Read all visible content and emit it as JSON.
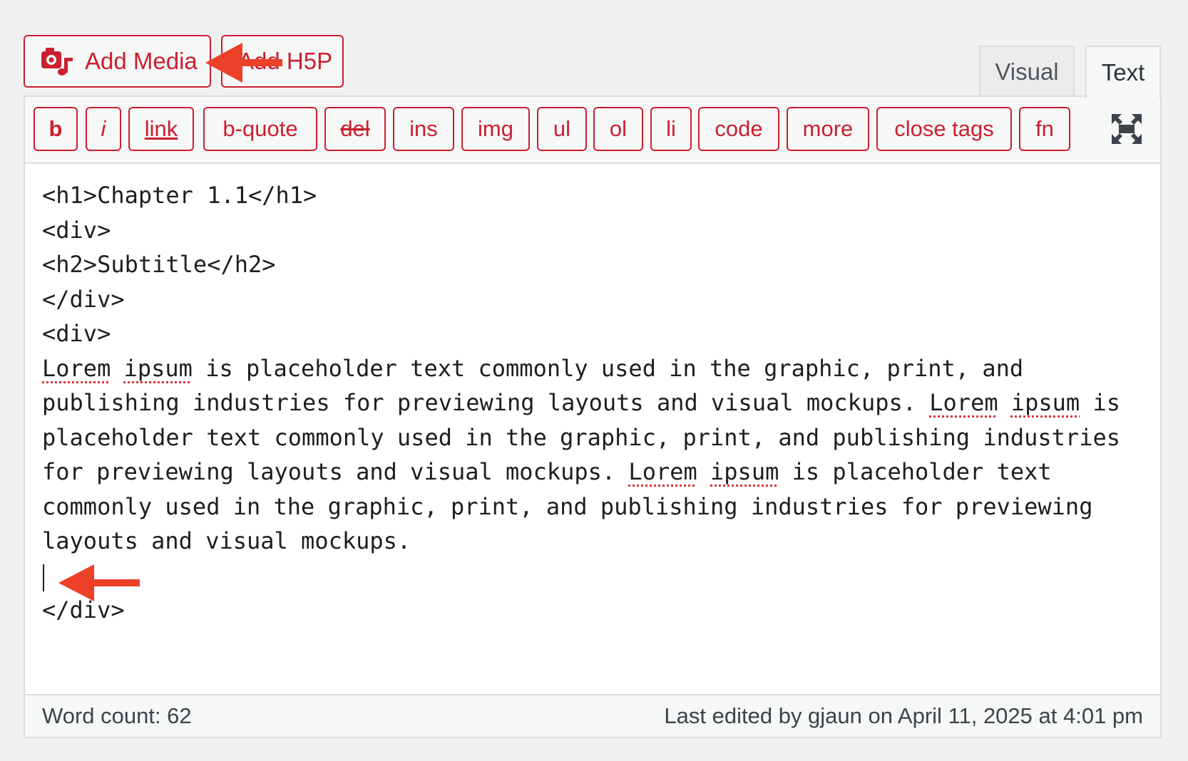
{
  "colors": {
    "accent": "#cc1f2f",
    "annotation_arrow": "#ec4028",
    "page_background": "#f0f0f1",
    "border": "#dcdcde"
  },
  "media_buttons": {
    "add_media": {
      "label": "Add Media",
      "icon": "media-camera-music-icon"
    },
    "add_h5p": {
      "label": "Add H5P"
    }
  },
  "tabs": {
    "visual": "Visual",
    "text": "Text",
    "active": "Text"
  },
  "quicktags": [
    {
      "id": "b",
      "label": "b"
    },
    {
      "id": "i",
      "label": "i"
    },
    {
      "id": "link",
      "label": "link"
    },
    {
      "id": "b-quote",
      "label": "b-quote"
    },
    {
      "id": "del",
      "label": "del"
    },
    {
      "id": "ins",
      "label": "ins"
    },
    {
      "id": "img",
      "label": "img"
    },
    {
      "id": "ul",
      "label": "ul"
    },
    {
      "id": "ol",
      "label": "ol"
    },
    {
      "id": "li",
      "label": "li"
    },
    {
      "id": "code",
      "label": "code"
    },
    {
      "id": "more",
      "label": "more"
    },
    {
      "id": "close-tags",
      "label": "close tags"
    },
    {
      "id": "fn",
      "label": "fn"
    }
  ],
  "fullscreen_icon": "fullscreen-icon",
  "editor": {
    "lines": [
      "<h1>Chapter 1.1</h1>",
      "<div>",
      "<h2>Subtitle</h2>",
      "</div>",
      "<div>"
    ],
    "paragraph": {
      "s1_spell1": "Lorem",
      "s1_spell2": "ipsum",
      "s1_rest": "is placeholder text commonly used in the graphic, print, and publishing industries for previewing layouts and visual mockups.",
      "s2_spell1": "Lorem",
      "s2_spell2": "ipsum",
      "s2_rest": "is placeholder text commonly used in the graphic, print, and publishing industries for previewing layouts and visual mockups.",
      "s3_spell1": "Lorem",
      "s3_spell2": "ipsum",
      "s3_rest": "is placeholder text commonly used in the graphic, print, and publishing industries for previewing layouts and visual mockups."
    },
    "closing_line": "</div>"
  },
  "status": {
    "word_count": "Word count: 62",
    "last_edited": "Last edited by gjaun on April 11, 2025 at 4:01 pm"
  }
}
